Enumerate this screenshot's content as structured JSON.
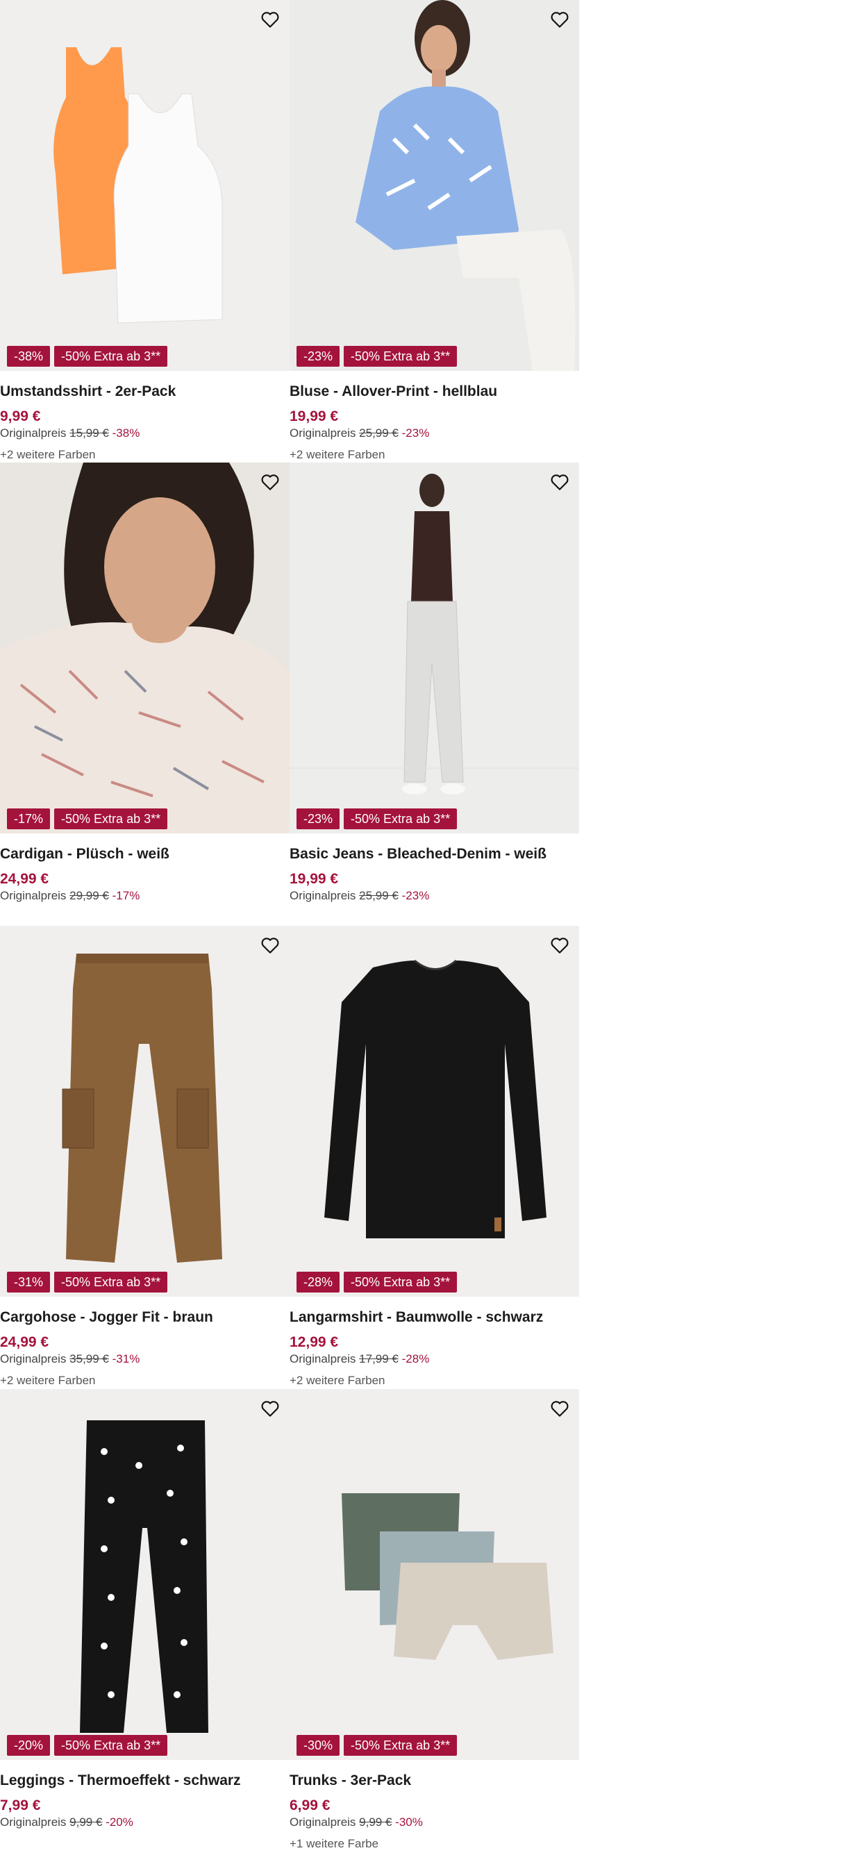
{
  "products": [
    {
      "title": "Umstandsshirt - 2er-Pack",
      "price": "9,99 €",
      "original_label": "Originalpreis",
      "original_price": "15,99 €",
      "discount": "-38%",
      "badges": [
        "-38%",
        "-50% Extra ab 3**"
      ],
      "colors": "+2 weitere Farben",
      "image": "tank-tops-orange-white"
    },
    {
      "title": "Bluse - Allover-Print - hellblau",
      "price": "19,99 €",
      "original_label": "Originalpreis",
      "original_price": "25,99 €",
      "discount": "-23%",
      "badges": [
        "-23%",
        "-50% Extra ab 3**"
      ],
      "colors": "+2 weitere Farben",
      "image": "model-blue-blouse"
    },
    {
      "title": "Cardigan - Plüsch - weiß",
      "price": "24,99 €",
      "original_label": "Originalpreis",
      "original_price": "29,99 €",
      "discount": "-17%",
      "badges": [
        "-17%",
        "-50% Extra ab 3**"
      ],
      "colors": "",
      "image": "model-white-cardigan"
    },
    {
      "title": "Basic Jeans - Bleached-Denim - weiß",
      "price": "19,99 €",
      "original_label": "Originalpreis",
      "original_price": "25,99 €",
      "discount": "-23%",
      "badges": [
        "-23%",
        "-50% Extra ab 3**"
      ],
      "colors": "",
      "image": "model-white-jeans"
    },
    {
      "title": "Cargohose - Jogger Fit - braun",
      "price": "24,99 €",
      "original_label": "Originalpreis",
      "original_price": "35,99 €",
      "discount": "-31%",
      "badges": [
        "-31%",
        "-50% Extra ab 3**"
      ],
      "colors": "+2 weitere Farben",
      "image": "brown-cargo-pants"
    },
    {
      "title": "Langarmshirt - Baumwolle - schwarz",
      "price": "12,99 €",
      "original_label": "Originalpreis",
      "original_price": "17,99 €",
      "discount": "-28%",
      "badges": [
        "-28%",
        "-50% Extra ab 3**"
      ],
      "colors": "+2 weitere Farben",
      "image": "black-longsleeve"
    },
    {
      "title": "Leggings - Thermoeffekt - schwarz",
      "price": "7,99 €",
      "original_label": "Originalpreis",
      "original_price": "9,99 €",
      "discount": "-20%",
      "badges": [
        "-20%",
        "-50% Extra ab 3**"
      ],
      "colors": "",
      "image": "black-bow-leggings"
    },
    {
      "title": "Trunks - 3er-Pack",
      "price": "6,99 €",
      "original_label": "Originalpreis",
      "original_price": "9,99 €",
      "discount": "-30%",
      "badges": [
        "-30%",
        "-50% Extra ab 3**"
      ],
      "colors": "+1 weitere Farbe",
      "image": "trunks-3-pack"
    }
  ],
  "icons": {
    "wishlist": "heart-outline-icon"
  },
  "colors": {
    "accent": "#a4133c",
    "image_bg": "#f0efee"
  }
}
